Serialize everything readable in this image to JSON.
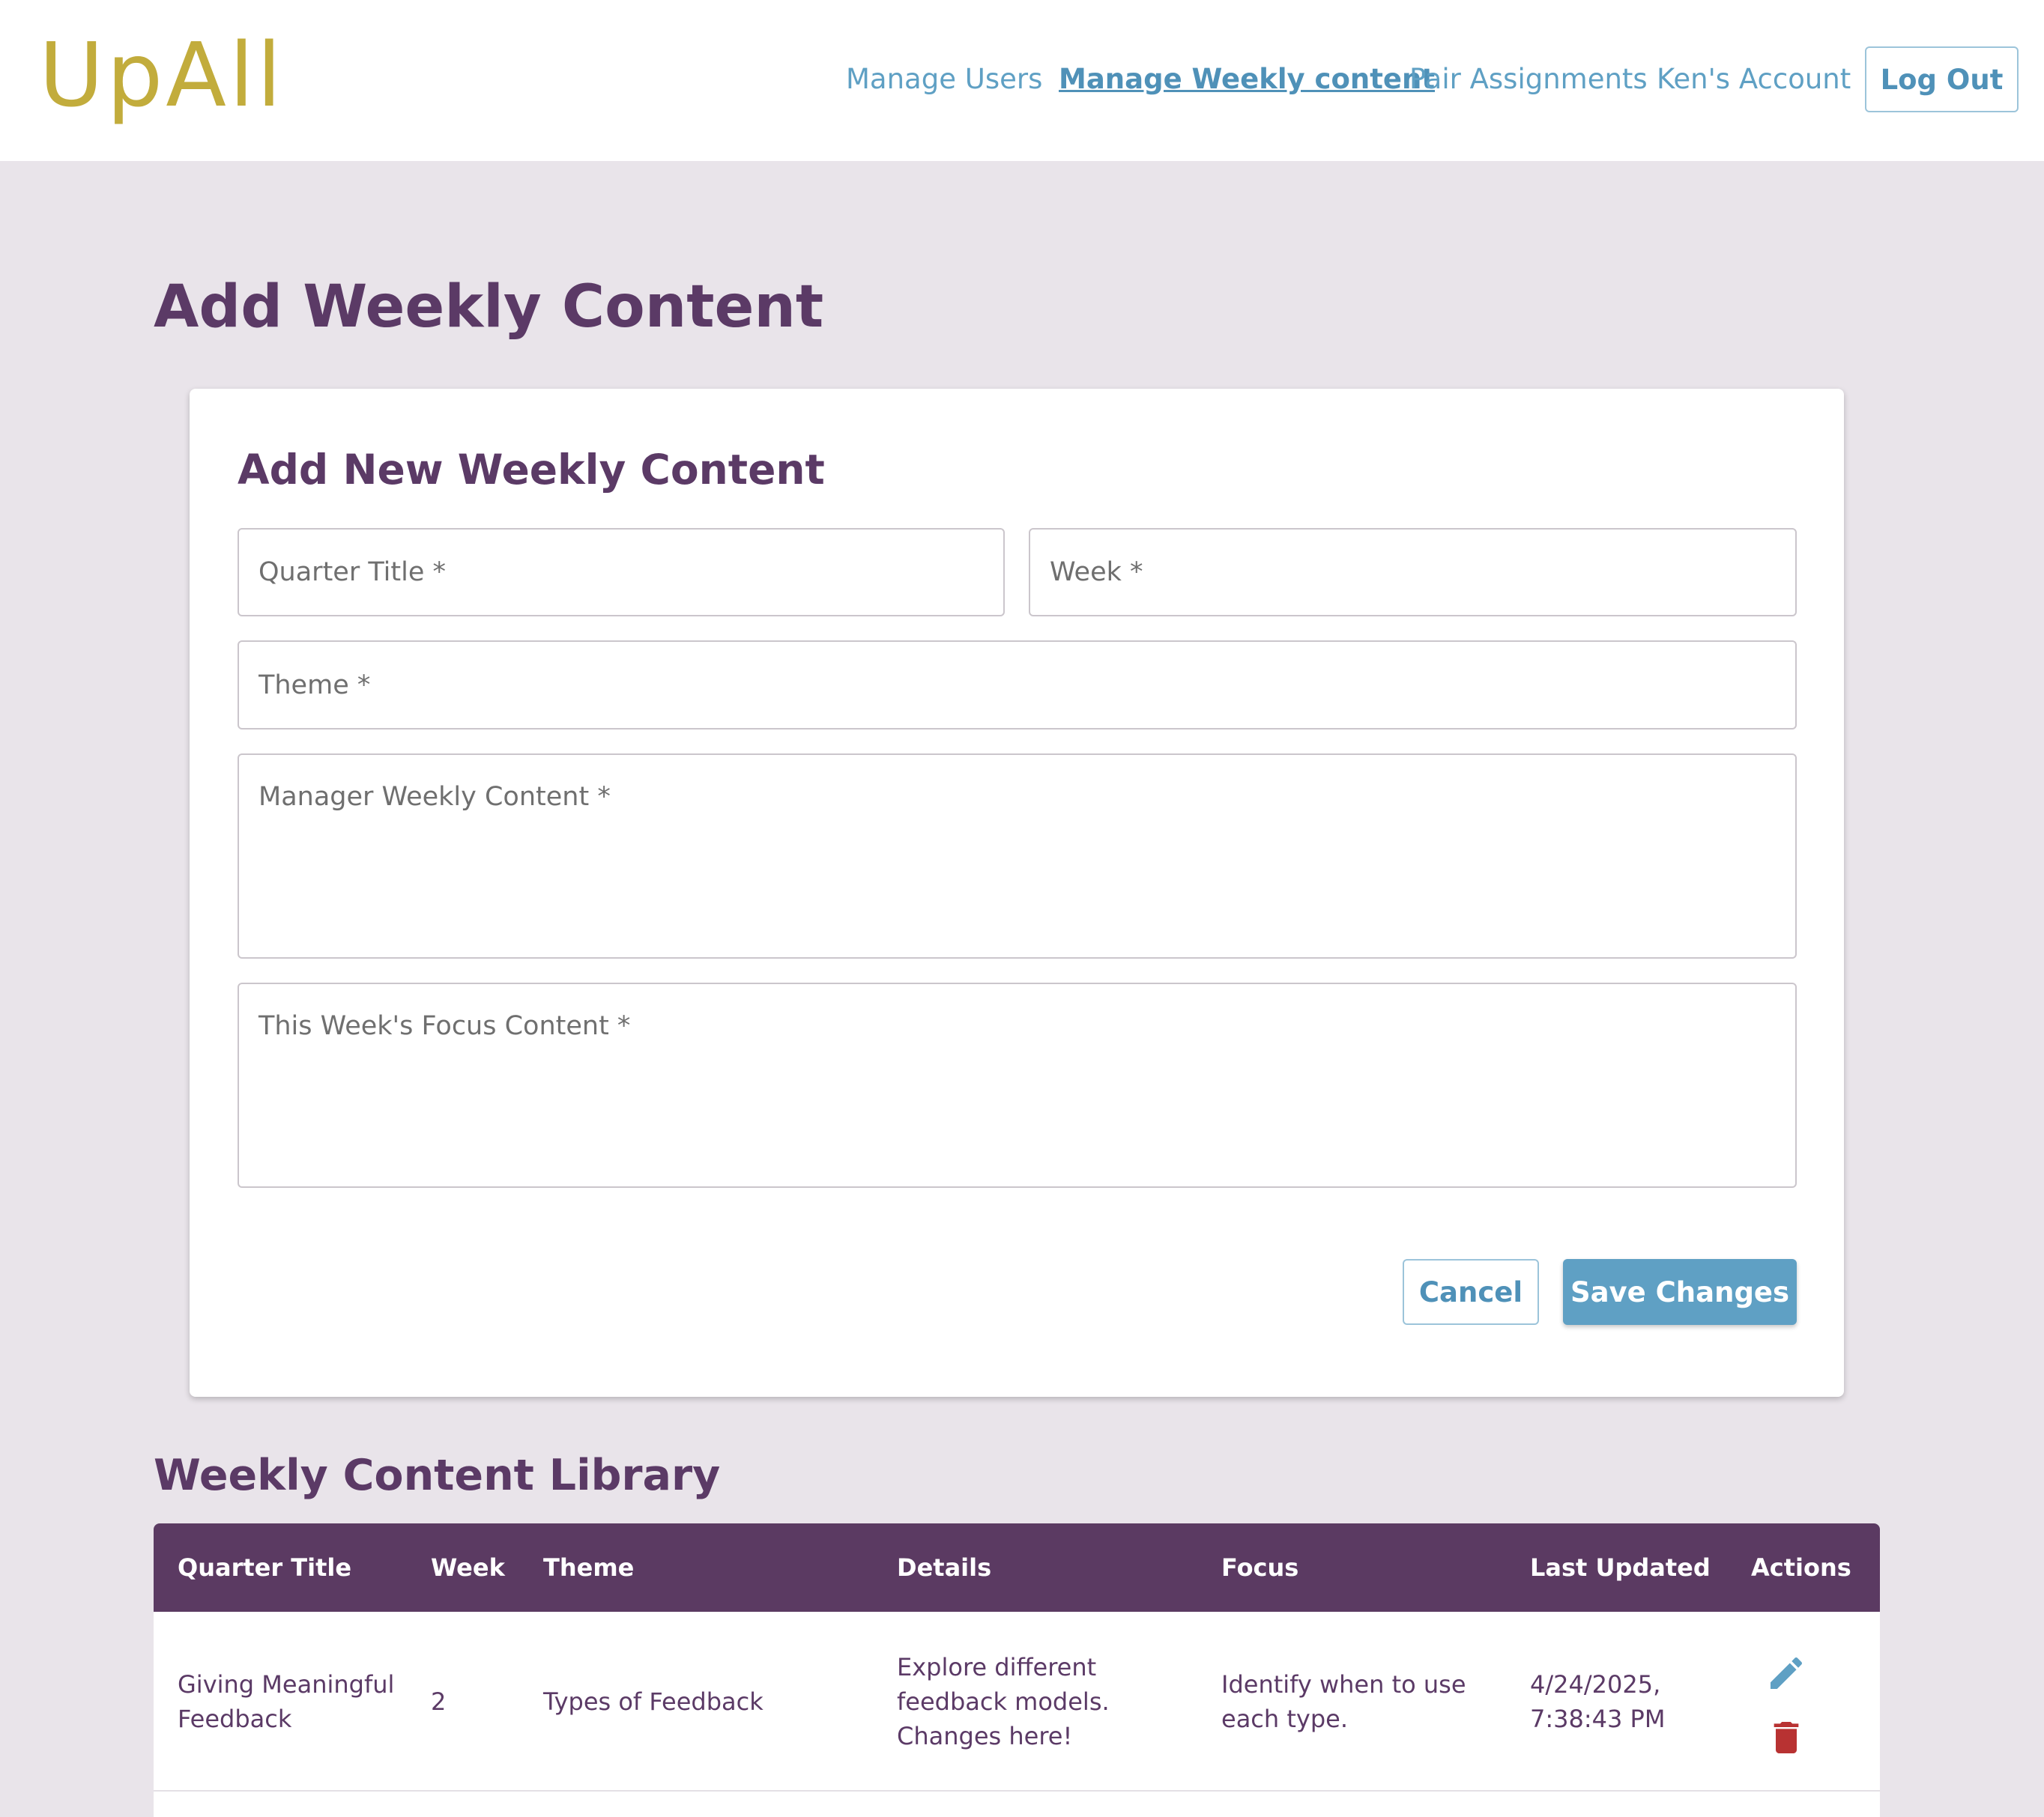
{
  "brand": {
    "logo_text": "UpAll"
  },
  "nav": {
    "items": [
      {
        "label": "Manage Users"
      },
      {
        "label": "Manage Weekly content"
      },
      {
        "label": "Pair Assignments"
      },
      {
        "label": "Ken's Account"
      }
    ],
    "logout_label": "Log Out"
  },
  "page": {
    "title": "Add Weekly Content"
  },
  "form": {
    "title": "Add New Weekly Content",
    "quarter_title": {
      "placeholder": "Quarter Title *",
      "value": ""
    },
    "week": {
      "placeholder": "Week *",
      "value": ""
    },
    "theme": {
      "placeholder": "Theme *",
      "value": ""
    },
    "manager_content": {
      "placeholder": "Manager Weekly Content *",
      "value": ""
    },
    "focus_content": {
      "placeholder": "This Week's Focus Content *",
      "value": ""
    },
    "cancel_label": "Cancel",
    "save_label": "Save Changes"
  },
  "library": {
    "title": "Weekly Content Library",
    "columns": [
      "Quarter Title",
      "Week",
      "Theme",
      "Details",
      "Focus",
      "Last Updated",
      "Actions"
    ],
    "rows": [
      {
        "quarter_title": "Giving Meaningful Feedback",
        "week": "2",
        "theme": "Types of Feedback",
        "details": "Explore different feedback models. Changes here!",
        "focus": "Identify when to use each type.",
        "last_updated": "4/24/2025, 7:38:43 PM",
        "actions": [
          "pencil-icon",
          "trash-icon"
        ]
      }
    ]
  },
  "colors": {
    "brand_gold": "#c2ac3c",
    "link_blue": "#5fa0c4",
    "header_purple": "#5b3a62",
    "delete_red": "#b83232",
    "page_bg": "#e9e4ea"
  }
}
